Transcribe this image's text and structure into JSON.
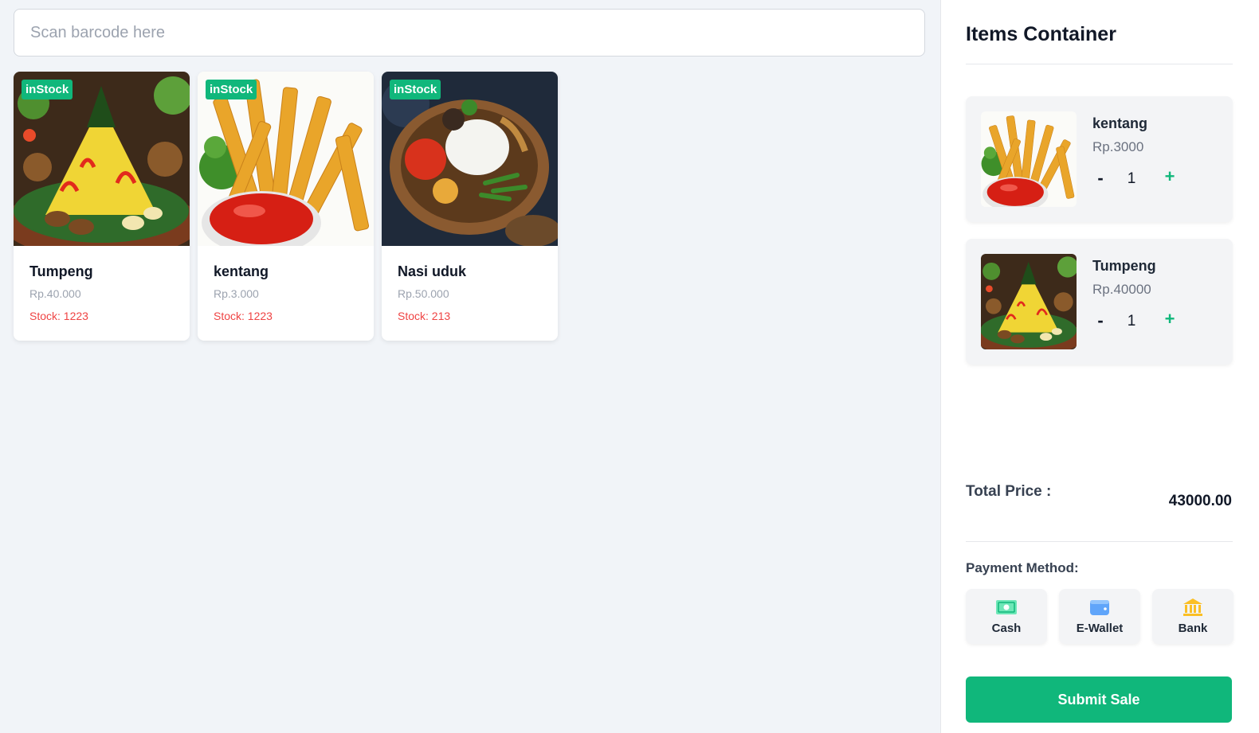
{
  "search": {
    "placeholder": "Scan barcode here"
  },
  "products": [
    {
      "name": "Tumpeng",
      "price": "Rp.40.000",
      "stock": "Stock: 1223",
      "badge": "inStock",
      "image": "tumpeng-rice-photo"
    },
    {
      "name": "kentang",
      "price": "Rp.3.000",
      "stock": "Stock: 1223",
      "badge": "inStock",
      "image": "french-fries-photo"
    },
    {
      "name": "Nasi uduk",
      "price": "Rp.50.000",
      "stock": "Stock: 213",
      "badge": "inStock",
      "image": "nasi-uduk-photo"
    }
  ],
  "cart": {
    "title": "Items Container",
    "items": [
      {
        "name": "kentang",
        "price": "Rp.3000",
        "qty": "1",
        "minus": "-",
        "plus": "+",
        "image": "french-fries-photo"
      },
      {
        "name": "Tumpeng",
        "price": "Rp.40000",
        "qty": "1",
        "minus": "-",
        "plus": "+",
        "image": "tumpeng-rice-photo"
      }
    ],
    "total_label": "Total Price :",
    "total_value": "43000.00",
    "payment_label": "Payment Method:",
    "payment_methods": [
      {
        "label": "Cash",
        "icon": "cash-icon"
      },
      {
        "label": "E-Wallet",
        "icon": "wallet-icon"
      },
      {
        "label": "Bank",
        "icon": "bank-icon"
      }
    ],
    "submit_label": "Submit Sale"
  },
  "colors": {
    "accent": "#10b77b",
    "stock": "#ef4444",
    "background": "#f1f4f8"
  }
}
